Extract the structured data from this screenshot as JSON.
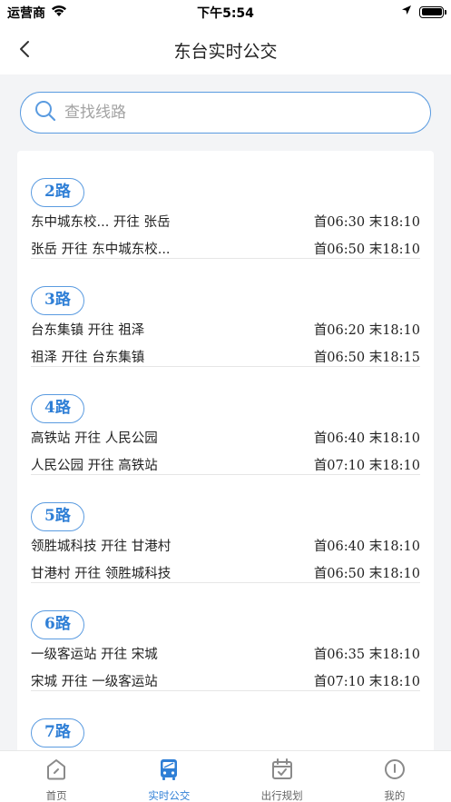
{
  "status_bar": {
    "carrier": "运营商",
    "time": "下午5:54"
  },
  "nav": {
    "title": "东台实时公交"
  },
  "search": {
    "placeholder": "查找线路",
    "value": ""
  },
  "routes": [
    {
      "name": "2路",
      "directions": [
        {
          "label": "东中城东校... 开往 张岳",
          "schedule": "首06:30 末18:10"
        },
        {
          "label": "张岳 开往 东中城东校...",
          "schedule": "首06:50 末18:10"
        }
      ]
    },
    {
      "name": "3路",
      "directions": [
        {
          "label": "台东集镇 开往 祖泽",
          "schedule": "首06:20 末18:10"
        },
        {
          "label": "祖泽 开往 台东集镇",
          "schedule": "首06:50 末18:15"
        }
      ]
    },
    {
      "name": "4路",
      "directions": [
        {
          "label": "高铁站 开往 人民公园",
          "schedule": "首06:40 末18:10"
        },
        {
          "label": "人民公园 开往 高铁站",
          "schedule": "首07:10 末18:10"
        }
      ]
    },
    {
      "name": "5路",
      "directions": [
        {
          "label": "领胜城科技 开往 甘港村",
          "schedule": "首06:40 末18:10"
        },
        {
          "label": "甘港村 开往 领胜城科技",
          "schedule": "首06:50 末18:10"
        }
      ]
    },
    {
      "name": "6路",
      "directions": [
        {
          "label": "一级客运站 开往 宋城",
          "schedule": "首06:35 末18:10"
        },
        {
          "label": "宋城 开往 一级客运站",
          "schedule": "首07:10 末18:10"
        }
      ]
    },
    {
      "name": "7路",
      "directions": []
    }
  ],
  "tabs": [
    {
      "label": "首页",
      "icon": "home-icon",
      "active": false
    },
    {
      "label": "实时公交",
      "icon": "bus-icon",
      "active": true
    },
    {
      "label": "出行规划",
      "icon": "calendar-icon",
      "active": false
    },
    {
      "label": "我的",
      "icon": "profile-icon",
      "active": false
    }
  ],
  "colors": {
    "accent": "#2f7fd6",
    "border_accent": "#5a9be0",
    "inactive_icon": "#8a8a8a"
  }
}
